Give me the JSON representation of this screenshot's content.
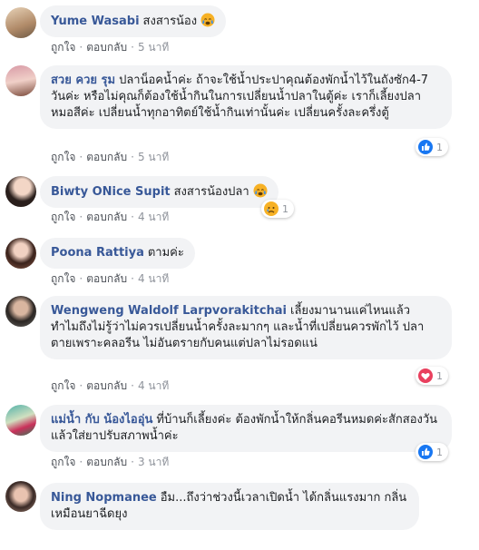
{
  "actions": {
    "like": "ถูกใจ",
    "reply": "ตอบกลับ",
    "sep": "·"
  },
  "comments": [
    {
      "author": "Yume Wasabi",
      "text": "สงสารน้อง",
      "time": "5 นาที",
      "emoji": "crying-face"
    },
    {
      "author": "สวย ควย รุม",
      "text": "ปลาน็อคน้ำค่ะ ถ้าจะใช้น้ำประปาคุณต้องพักน้ำไว้ในถังซัก4-7 วันค่ะ หรือไม่คุณก็ต้องใช้น้ำกินในการเปลี่ยนน้ำปลาในตู้ค่ะ เราก็เลี้ยงปลาหมอสีค่ะ เปลี่ยนน้ำทุกอาทิตย์ใช้น้ำกินเท่านั้นค่ะ เปลี่ยนครั้งละครึ่งตู้",
      "time": "5 นาที",
      "reaction": {
        "type": "like",
        "count": "1"
      }
    },
    {
      "author": "Biwty ONice Supit",
      "text": "สงสารน้องปลา",
      "time": "4 นาที",
      "emoji": "crying-face",
      "reaction": {
        "type": "sad",
        "count": "1"
      }
    },
    {
      "author": "Poona Rattiya",
      "text": "ตามค่ะ",
      "time": "4 นาที"
    },
    {
      "author": "Wengweng Waldolf Larpvorakitchai",
      "text": "เลี้ยงมานานแค่ไหนแล้ว ทำไมถึงไม่รู้ว่าไม่ควรเปลี่ยนน้ำครั้งละมากๆ และน้ำที่เปลี่ยนควรพักไว้ ปลาตายเพราะคลอรีน ไม่อันตรายกับคนแต่ปลาไม่รอดแน่",
      "time": "4 นาที",
      "reaction": {
        "type": "love",
        "count": "1"
      }
    },
    {
      "author": "แม่น้ำ กับ น้องไออุ่น",
      "text": "ที่บ้านก็เลี้ยงค่ะ ต้องพักน้ำให้กลิ่นคอรีนหมดค่ะสักสองวันแล้วใส่ยาปรับสภาพน้ำค่ะ",
      "time": "3 นาที",
      "reaction": {
        "type": "like",
        "count": "1"
      }
    },
    {
      "author": "Ning Nopmanee",
      "text": "อืม...ถึงว่าช่วงนี้เวลาเปิดน้ำ ได้กลิ่นแรงมาก กลิ่นเหมือนยาฉีดยุง"
    }
  ],
  "colors": {
    "author": "#385898",
    "bubble": "#f2f3f5",
    "like": "#1877f2",
    "love": "#e9405e",
    "sad": "#f7b125"
  }
}
